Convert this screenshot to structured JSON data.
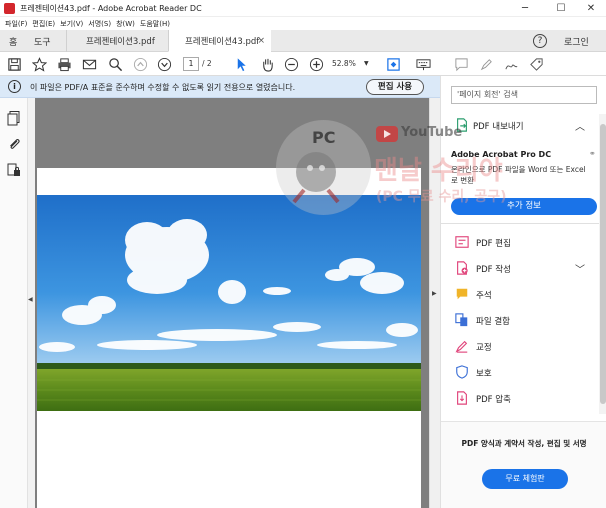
{
  "window": {
    "title": "프레젠테이션43.pdf - Adobe Acrobat Reader DC",
    "minimize": "─",
    "maximize": "☐",
    "close": "✕"
  },
  "menu": [
    "파일(F)",
    "편집(E)",
    "보기(V)",
    "서명(S)",
    "창(W)",
    "도움말(H)"
  ],
  "tabs": {
    "home": "홈",
    "tools": "도구",
    "docs": [
      {
        "label": "프레젠테이션3.pdf",
        "active": false
      },
      {
        "label": "프레젠테이션43.pdf",
        "active": true
      }
    ],
    "close_glyph": "×",
    "help": "?",
    "login": "로그인"
  },
  "toolbar": {
    "current_page": "1",
    "total_pages": "/ 2",
    "zoom": "52.8%"
  },
  "infobar": {
    "message": "이 파일은 PDF/A 표준을 준수하며 수정할 수 없도록 읽기 전용으로 열렸습니다.",
    "edit_button": "편집 사용"
  },
  "right_panel": {
    "search_placeholder": "'페이지 회전' 검색",
    "export_header": "PDF 내보내기",
    "export_title": "Adobe Acrobat Pro DC",
    "export_desc": "온라인으로 PDF 파일을 Word 또는 Excel 로 변환",
    "more_info_button": "추가 정보",
    "tools": [
      {
        "label": "PDF 편집",
        "icon": "edit-pdf-icon",
        "color": "#e0457b"
      },
      {
        "label": "PDF 작성",
        "icon": "create-pdf-icon",
        "color": "#e0457b"
      },
      {
        "label": "주석",
        "icon": "comment-icon",
        "color": "#f0b429"
      },
      {
        "label": "파일 결합",
        "icon": "combine-files-icon",
        "color": "#3b6fd6"
      },
      {
        "label": "교정",
        "icon": "redact-icon",
        "color": "#e0457b"
      },
      {
        "label": "보호",
        "icon": "protect-icon",
        "color": "#3b6fd6"
      },
      {
        "label": "PDF 압축",
        "icon": "compress-pdf-icon",
        "color": "#e0457b"
      }
    ],
    "promo_text": "PDF 양식과 계약서 작성, 편집 및 서명",
    "trial_button": "무료 체험판"
  },
  "watermark": {
    "pc_text": "PC",
    "youtube_text": "YouTube",
    "channel_text": "맨날 수리야",
    "channel_sub": "(PC 무료 수리, 공구)"
  },
  "colors": {
    "accent": "#1a73e8",
    "info_bar": "#dbe9f8",
    "doc_background": "#7f7f7f"
  }
}
